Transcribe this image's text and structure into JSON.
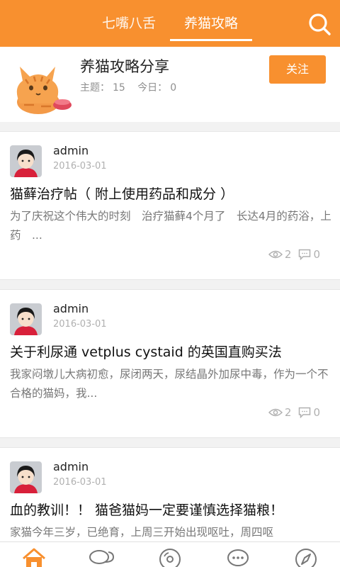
{
  "header": {
    "tabs": [
      {
        "label": "七嘴八舌",
        "active": false
      },
      {
        "label": "养猫攻略",
        "active": true
      }
    ],
    "accent_color": "#f8902f"
  },
  "forum": {
    "title": "养猫攻略分享",
    "topics_label": "主题：",
    "topics_count": "15",
    "today_label": "今日：",
    "today_count": "0",
    "follow_label": "关注"
  },
  "posts": [
    {
      "author": "admin",
      "date": "2016-03-01",
      "title": "猫藓治疗帖（ 附上使用药品和成分 ）",
      "excerpt": "为了庆祝这个伟大的时刻　治疗猫藓4个月了　长达4月的药浴，上药　...",
      "views": "2",
      "comments": "0"
    },
    {
      "author": "admin",
      "date": "2016-03-01",
      "title": "关于利尿通 vetplus cystaid 的英国直购买法",
      "excerpt": "我家闷墩儿大病初愈，尿闭两天，尿结晶外加尿中毒，作为一个不合格的猫妈，我...",
      "views": "2",
      "comments": "0"
    },
    {
      "author": "admin",
      "date": "2016-03-01",
      "title": "血的教训！！ 猫爸猫妈一定要谨慎选择猫粮！",
      "excerpt": "家猫今年三岁，已绝育，上周三开始出现呕吐，周四呕"
    }
  ],
  "bottom_nav": [
    {
      "icon": "home-icon",
      "active": true
    },
    {
      "icon": "chat-bubbles-icon",
      "active": false
    },
    {
      "icon": "disc-icon",
      "active": false
    },
    {
      "icon": "message-dots-icon",
      "active": false
    },
    {
      "icon": "compass-icon",
      "active": false
    }
  ]
}
